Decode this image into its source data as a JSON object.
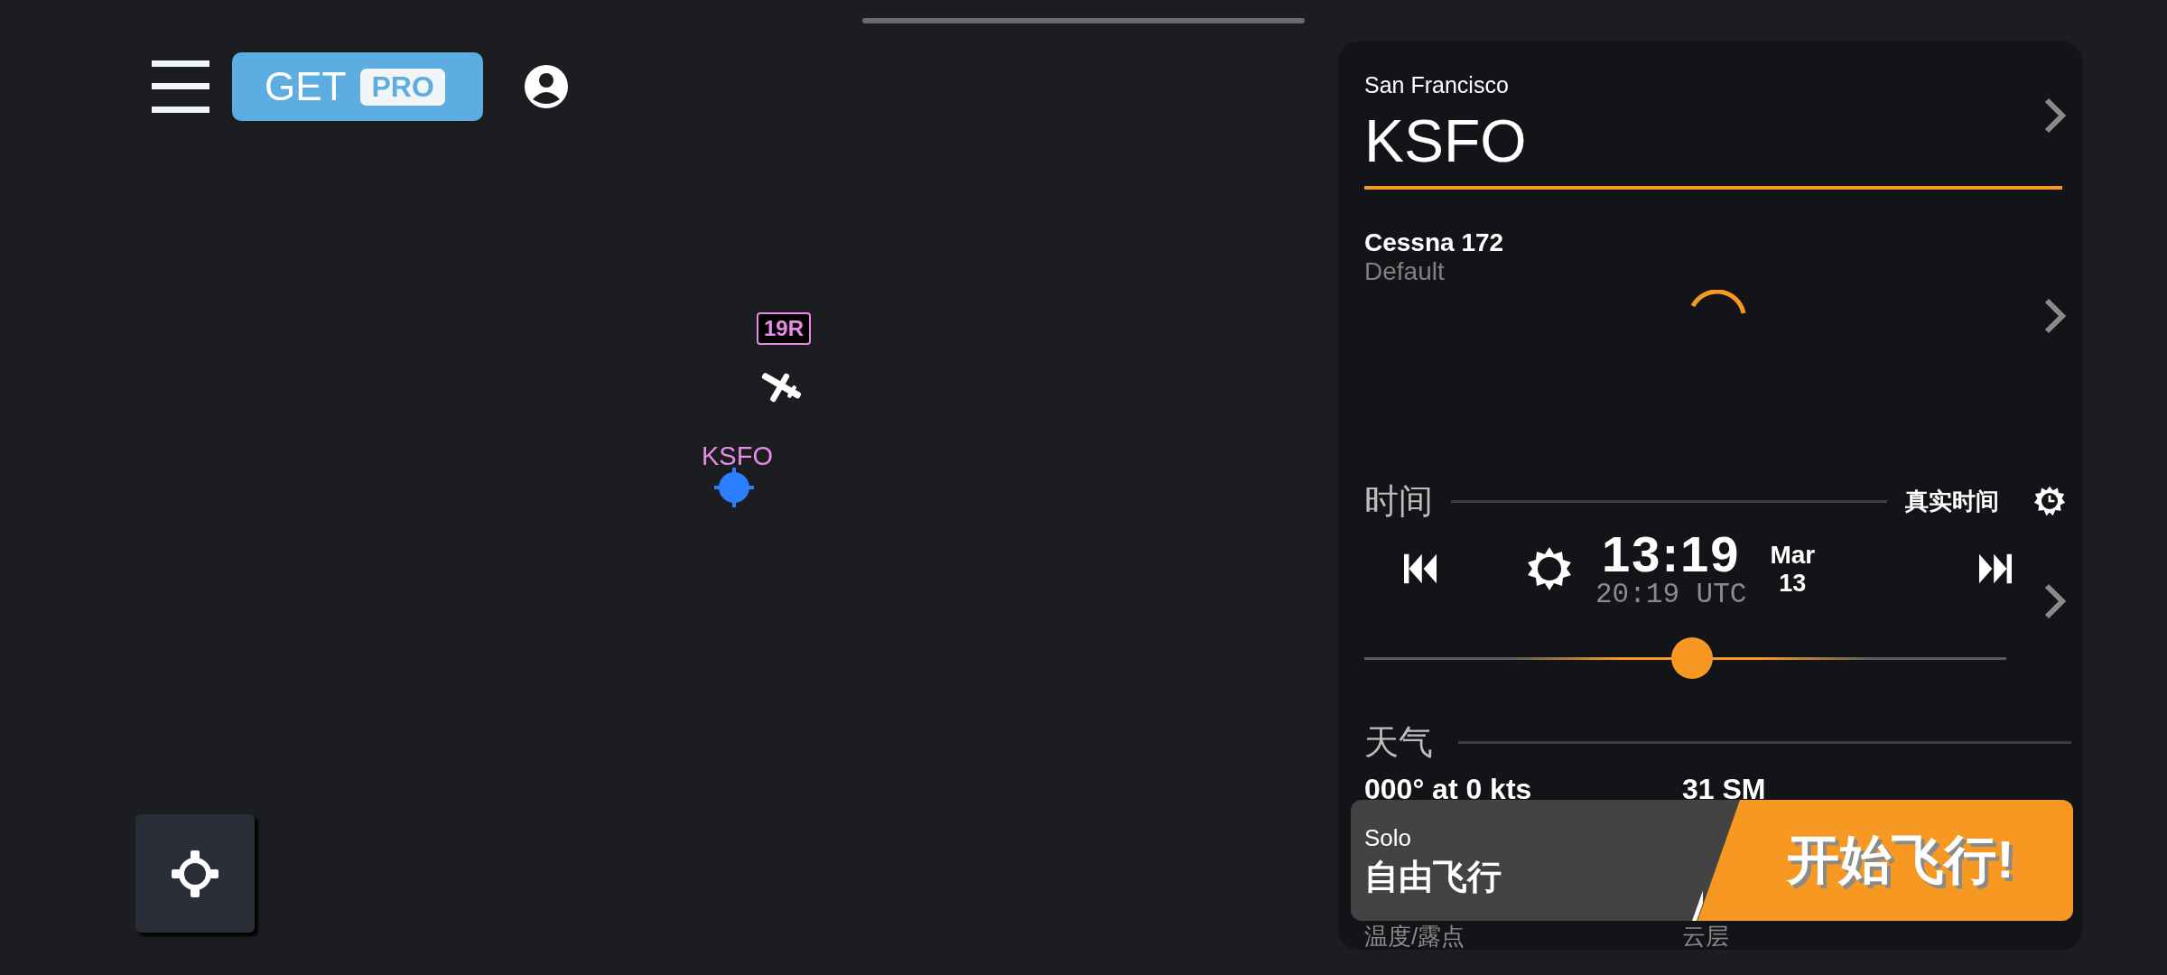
{
  "top_bar": {
    "pro_button": {
      "label": "GET",
      "badge": "PRO"
    }
  },
  "map": {
    "runway_label": "19R",
    "airport_label": "KSFO"
  },
  "airport": {
    "city": "San Francisco",
    "code": "KSFO"
  },
  "aircraft": {
    "name": "Cessna 172",
    "livery": "Default"
  },
  "time": {
    "heading": "时间",
    "real_time_label": "真实时间",
    "local_time": "13:19",
    "utc_time": "20:19 UTC",
    "month": "Mar",
    "day": "13",
    "level": 0.51
  },
  "weather": {
    "heading": "天气",
    "wind": "000° at 0 kts",
    "visibility": "31 SM",
    "labels": [
      "温度/露点",
      "云层"
    ]
  },
  "start": {
    "mode": "Solo",
    "mode_name": "自由飞行",
    "button": "开始飞行!"
  }
}
